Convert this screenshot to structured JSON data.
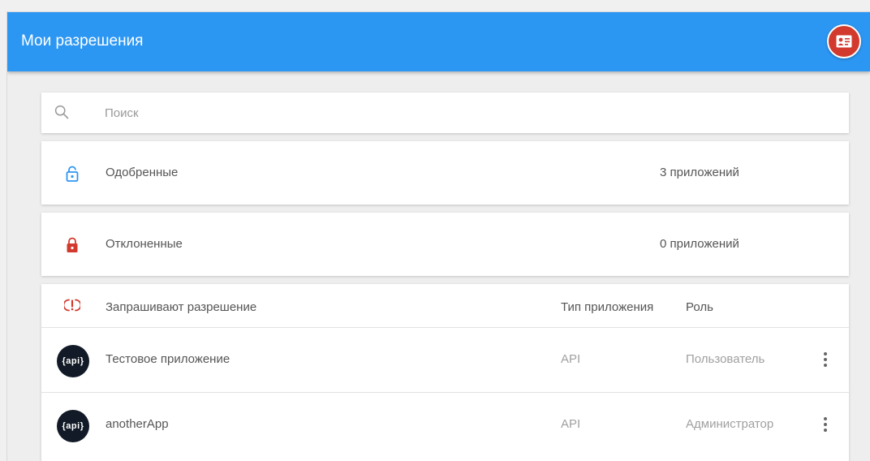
{
  "header": {
    "title": "Мои разрешения",
    "avatar_icon": "contact-card-icon",
    "color": "#2c97f3"
  },
  "search": {
    "icon": "search-icon",
    "placeholder": "Поиск",
    "value": ""
  },
  "groups": {
    "approved": {
      "icon": "unlocked-icon",
      "label": "Одобренные",
      "count": "3 приложений",
      "color": "#2c97f3"
    },
    "rejected": {
      "icon": "locked-icon",
      "label": "Отклоненные",
      "count": "0 приложений",
      "color": "#d23a2e"
    }
  },
  "requests": {
    "icon": "pending-request-icon",
    "title": "Запрашивают разрешение",
    "columns": {
      "type": "Тип приложения",
      "role": "Роль"
    },
    "rows": [
      {
        "avatar_text": "{api}",
        "name": "Тестовое приложение",
        "type": "API",
        "role": "Пользователь",
        "menu_icon": "more-vert-icon"
      },
      {
        "avatar_text": "{api}",
        "name": "anotherApp",
        "type": "API",
        "role": "Администратор",
        "menu_icon": "more-vert-icon"
      }
    ]
  }
}
